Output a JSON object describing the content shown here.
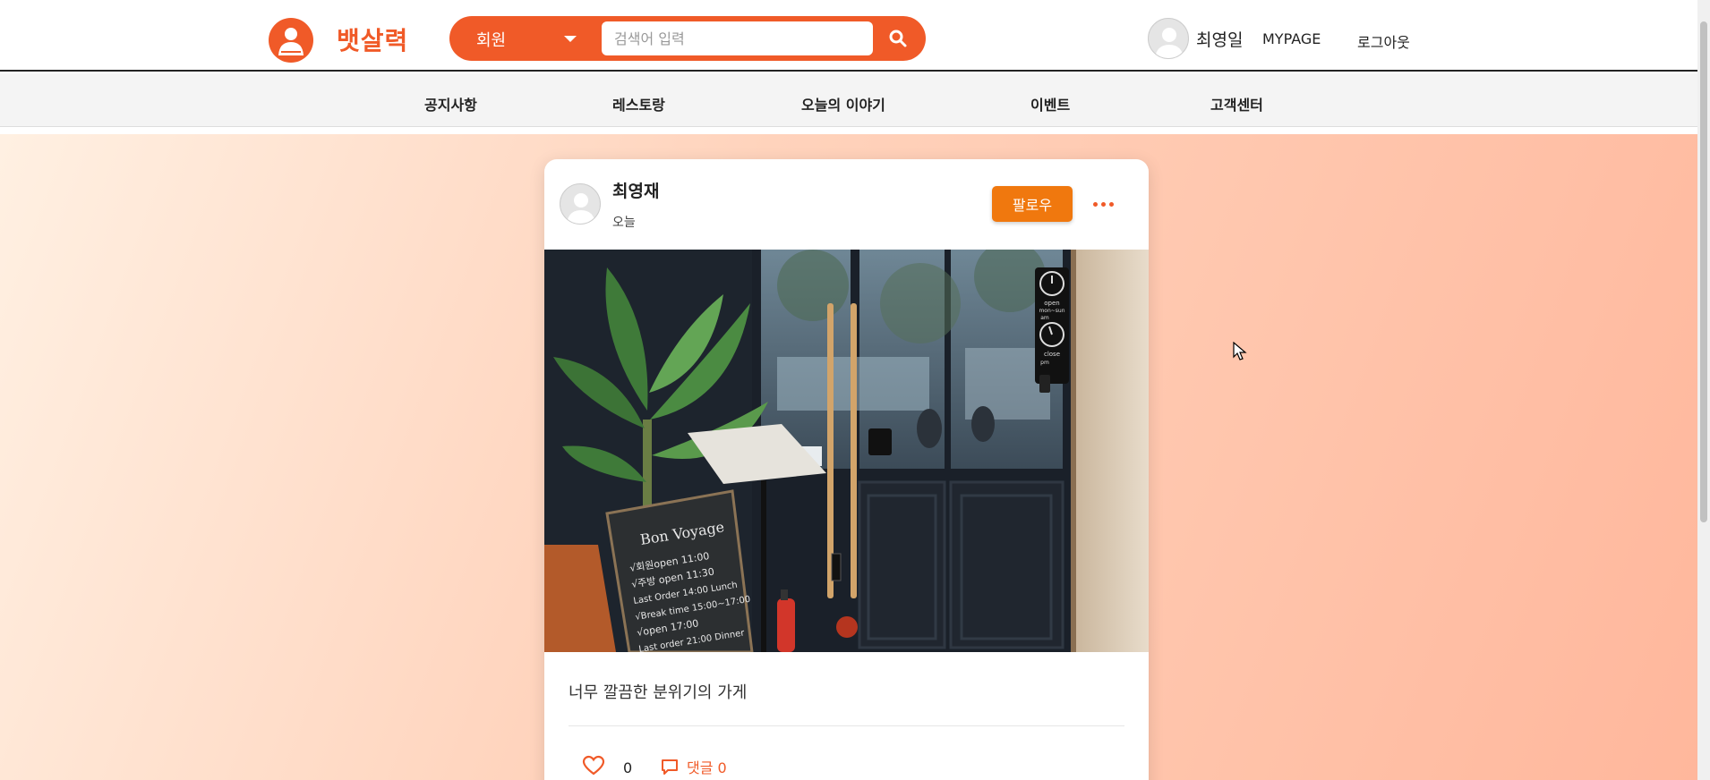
{
  "header": {
    "logo_text": "뱃살력",
    "search": {
      "category": "회원",
      "placeholder": "검색어 입력"
    },
    "user": {
      "name": "최영일",
      "mypage_label": "MYPAGE",
      "logout_label": "로그아웃"
    }
  },
  "nav": {
    "items": [
      {
        "label": "공지사항"
      },
      {
        "label": "레스토랑"
      },
      {
        "label": "오늘의 이야기"
      },
      {
        "label": "이벤트"
      },
      {
        "label": "고객센터"
      }
    ]
  },
  "post": {
    "author": "최영재",
    "time": "오늘",
    "follow_label": "팔로우",
    "text": "너무 깔끔한 분위기의 가게",
    "like_count": "0",
    "comment_label": "댓글 0",
    "photo": {
      "sign_labels": [
        "open",
        "mon~sun",
        "am",
        "close",
        "pm"
      ],
      "board_lines": [
        "Bon Voyage",
        "√회원open 11:00",
        "√주방 open 11:30",
        "Last Order 14:00 Lunch",
        "√Break time 15:00~17:00",
        "√open 17:00",
        "Last order 21:00 Dinner"
      ]
    }
  },
  "colors": {
    "brand": "#f05a28",
    "follow": "#f0780e"
  }
}
